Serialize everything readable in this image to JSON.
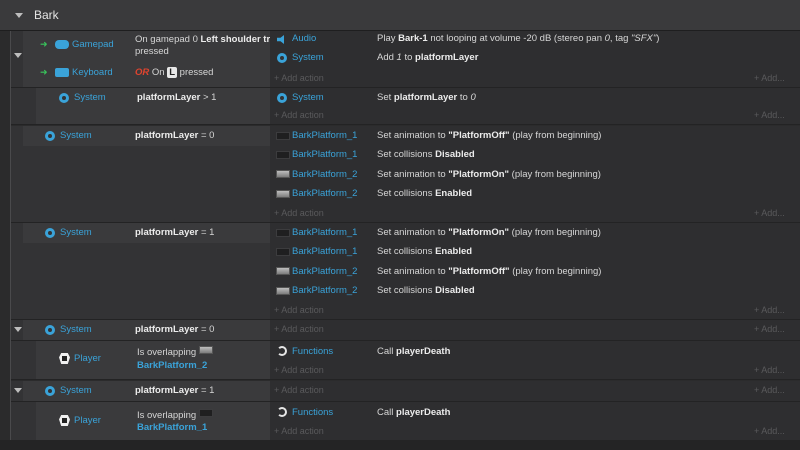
{
  "group": {
    "title": "Bark"
  },
  "common": {
    "add_action": "+ Add action",
    "add": "+ Add..."
  },
  "events": [
    {
      "conditions": [
        {
          "object": "Gamepad",
          "parts": [
            "On gamepad 0 ",
            "Left shoulder trigger",
            " pressed"
          ]
        },
        {
          "object": "Keyboard",
          "or": "OR",
          "on": "On",
          "key": "L",
          "tail": "pressed"
        }
      ],
      "actions": [
        {
          "object": "Audio",
          "text": [
            "Play ",
            "Bark-1",
            " not looping at volume -20 dB (stereo pan ",
            "0",
            ", tag ",
            "\"SFX\"",
            ")"
          ]
        },
        {
          "object": "System",
          "text": [
            "Add ",
            "1",
            " to ",
            "platformLayer"
          ]
        }
      ]
    },
    {
      "conditions": [
        {
          "object": "System",
          "parts": [
            "platformLayer",
            " > 1"
          ]
        }
      ],
      "actions": [
        {
          "object": "System",
          "text": [
            "Set ",
            "platformLayer",
            " to ",
            "0"
          ]
        }
      ]
    },
    {
      "conditions": [
        {
          "object": "System",
          "parts": [
            "platformLayer",
            " = 0"
          ]
        }
      ],
      "actions": [
        {
          "object": "BarkPlatform_1",
          "text": [
            "Set animation to ",
            "\"PlatformOff\"",
            " (play from beginning)"
          ]
        },
        {
          "object": "BarkPlatform_1",
          "text": [
            "Set collisions ",
            "Disabled"
          ]
        },
        {
          "object": "BarkPlatform_2",
          "text": [
            "Set animation to ",
            "\"PlatformOn\"",
            " (play from beginning)"
          ]
        },
        {
          "object": "BarkPlatform_2",
          "text": [
            "Set collisions ",
            "Enabled"
          ]
        }
      ]
    },
    {
      "conditions": [
        {
          "object": "System",
          "parts": [
            "platformLayer",
            " = 1"
          ]
        }
      ],
      "actions": [
        {
          "object": "BarkPlatform_1",
          "text": [
            "Set animation to ",
            "\"PlatformOn\"",
            " (play from beginning)"
          ]
        },
        {
          "object": "BarkPlatform_1",
          "text": [
            "Set collisions ",
            "Enabled"
          ]
        },
        {
          "object": "BarkPlatform_2",
          "text": [
            "Set animation to ",
            "\"PlatformOff\"",
            " (play from beginning)"
          ]
        },
        {
          "object": "BarkPlatform_2",
          "text": [
            "Set collisions ",
            "Disabled"
          ]
        }
      ]
    },
    {
      "conditions": [
        {
          "object": "System",
          "parts": [
            "platformLayer",
            " = 0"
          ]
        }
      ],
      "actions": []
    },
    {
      "conditions": [
        {
          "object": "Player",
          "parts": [
            "Is overlapping ",
            "BarkPlatform_2"
          ]
        }
      ],
      "actions": [
        {
          "object": "Functions",
          "text": [
            "Call ",
            "playerDeath"
          ]
        }
      ]
    },
    {
      "conditions": [
        {
          "object": "System",
          "parts": [
            "platformLayer",
            " = 1"
          ]
        }
      ],
      "actions": []
    },
    {
      "conditions": [
        {
          "object": "Player",
          "parts": [
            "Is overlapping ",
            "BarkPlatform_1"
          ]
        }
      ],
      "actions": [
        {
          "object": "Functions",
          "text": [
            "Call ",
            "playerDeath"
          ]
        }
      ]
    }
  ]
}
